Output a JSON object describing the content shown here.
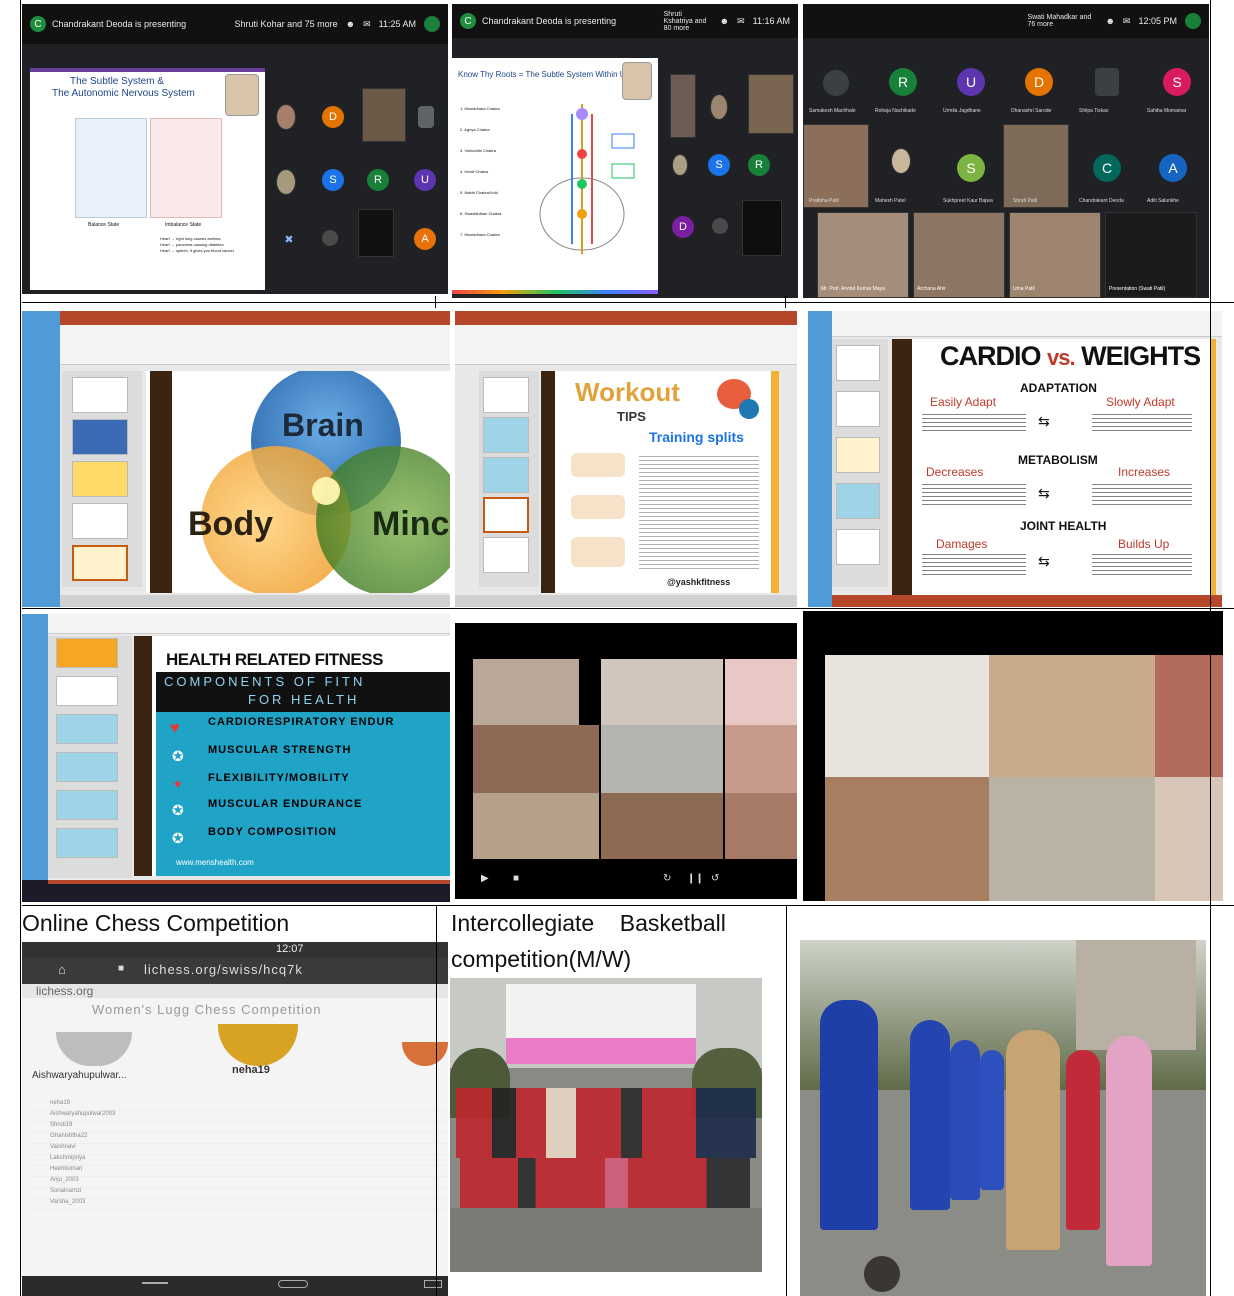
{
  "row1": {
    "meet1": {
      "presenter_banner": "Chandrakant Deoda is presenting",
      "participants_note": "Shruti Kohar and 75 more",
      "time": "11:25 AM",
      "slide_title_1": "The Subtle System &",
      "slide_title_2": "The Autonomic Nervous System",
      "left_caption": "Balance State",
      "right_caption": "Imbalance State",
      "notes": [
        "Heart → right lung causes asthma",
        "Heart → pancreas causing diabetes",
        "Heart → spleen, it gives you blood cancer"
      ],
      "tiles": [
        "D",
        "S",
        "R",
        "U",
        "A"
      ]
    },
    "meet2": {
      "presenter_banner": "Chandrakant Deoda is presenting",
      "participants_note": "Shruti Kshatriya and 80 more",
      "time": "11:16 AM",
      "slide_title": "Know Thy Roots = The Subtle System Within Us",
      "chakras": [
        "1. Mooladhara Chakra",
        "2. Agnya Chakra",
        "3. Vishuddhi Chakra",
        "4. Heart Chakra",
        "5. Nabhi Chakra/Void",
        "6. Swadishthan Chakra",
        "7. Mooladhara Chakra"
      ],
      "tiles": [
        "S",
        "R",
        "D"
      ]
    },
    "meet3": {
      "participants_note": "Swati Mahadkar and 76 more",
      "time": "12:05 PM",
      "tiles": [
        {
          "letter": "",
          "name": "Samakesh Machhale"
        },
        {
          "letter": "R",
          "name": "Rohaja Nachikade"
        },
        {
          "letter": "U",
          "name": "Urmila Jagdhane"
        },
        {
          "letter": "D",
          "name": "Dhanashri Sarode"
        },
        {
          "letter": "",
          "name": "Shilpa Tiskas"
        },
        {
          "letter": "S",
          "name": "Sahiba Momamar"
        }
      ],
      "row2_names": [
        "Pratibha Patil",
        "Mahesh Patel",
        "Sukhpreet Kaur Bajwa",
        "Shruti Patil",
        "Chandrakant Deoda",
        "Aditi Salunkhe"
      ],
      "row2_letters": [
        "S",
        "C",
        "A"
      ],
      "row3_names": [
        "Mr. Prof. Arvind Kumar Maya",
        "Archana Ahir",
        "Uma Patil",
        "Presentation (Swati Patil)"
      ]
    }
  },
  "row2": {
    "ppt1": {
      "words": [
        "Brain",
        "Body",
        "Minc"
      ]
    },
    "ppt2": {
      "title": "Workout",
      "subtitle": "TIPS",
      "heading": "Training splits",
      "footer": "@yashkfitness"
    },
    "ppt3": {
      "title_a": "CARDIO",
      "title_vs": "vs.",
      "title_b": "WEIGHTS",
      "sections": [
        {
          "heading": "ADAPTATION",
          "left": "Easily Adapt",
          "right": "Slowly Adapt"
        },
        {
          "heading": "METABOLISM",
          "left": "Decreases",
          "right": "Increases"
        },
        {
          "heading": "JOINT HEALTH",
          "left": "Damages",
          "right": "Builds Up"
        }
      ]
    }
  },
  "row3": {
    "ppt4": {
      "title": "HEALTH RELATED FITNESS",
      "subtitle_1": "COMPONENTS OF FITN",
      "subtitle_2": "FOR HEALTH",
      "items": [
        "CARDIORESPIRATORY ENDUR",
        "MUSCULAR STRENGTH",
        "FLEXIBILITY/MOBILITY",
        "MUSCULAR ENDURANCE",
        "BODY COMPOSITION"
      ],
      "footer": "www.menshealth.com"
    }
  },
  "row4": {
    "chess": {
      "caption": "Online Chess Competition",
      "status_time": "12:07",
      "url": "lichess.org/swiss/hcq7k",
      "site": "lichess.org",
      "tournament": "Women's Lugg Chess Competition",
      "winner": "neha19",
      "second": "Aishwaryahupulwar...",
      "rows": [
        "neha19",
        "Aishwaryahupulwar2003",
        "Shruti19",
        "Ghanishtha22",
        "Vaishnavi",
        "Lakshmipriya",
        "Heenkumari",
        "Anju_2003",
        "Sonalnamzi",
        "Varsha_2003"
      ]
    },
    "basketball": {
      "caption_1": "Intercollegiate    Basketball",
      "caption_2": "competition(M/W)"
    }
  },
  "colors": {
    "meet_bg": "#202124",
    "ppt_brown": "#3b2412",
    "fitness_teal": "#1fa3c7",
    "cardio_red": "#c0392b"
  }
}
